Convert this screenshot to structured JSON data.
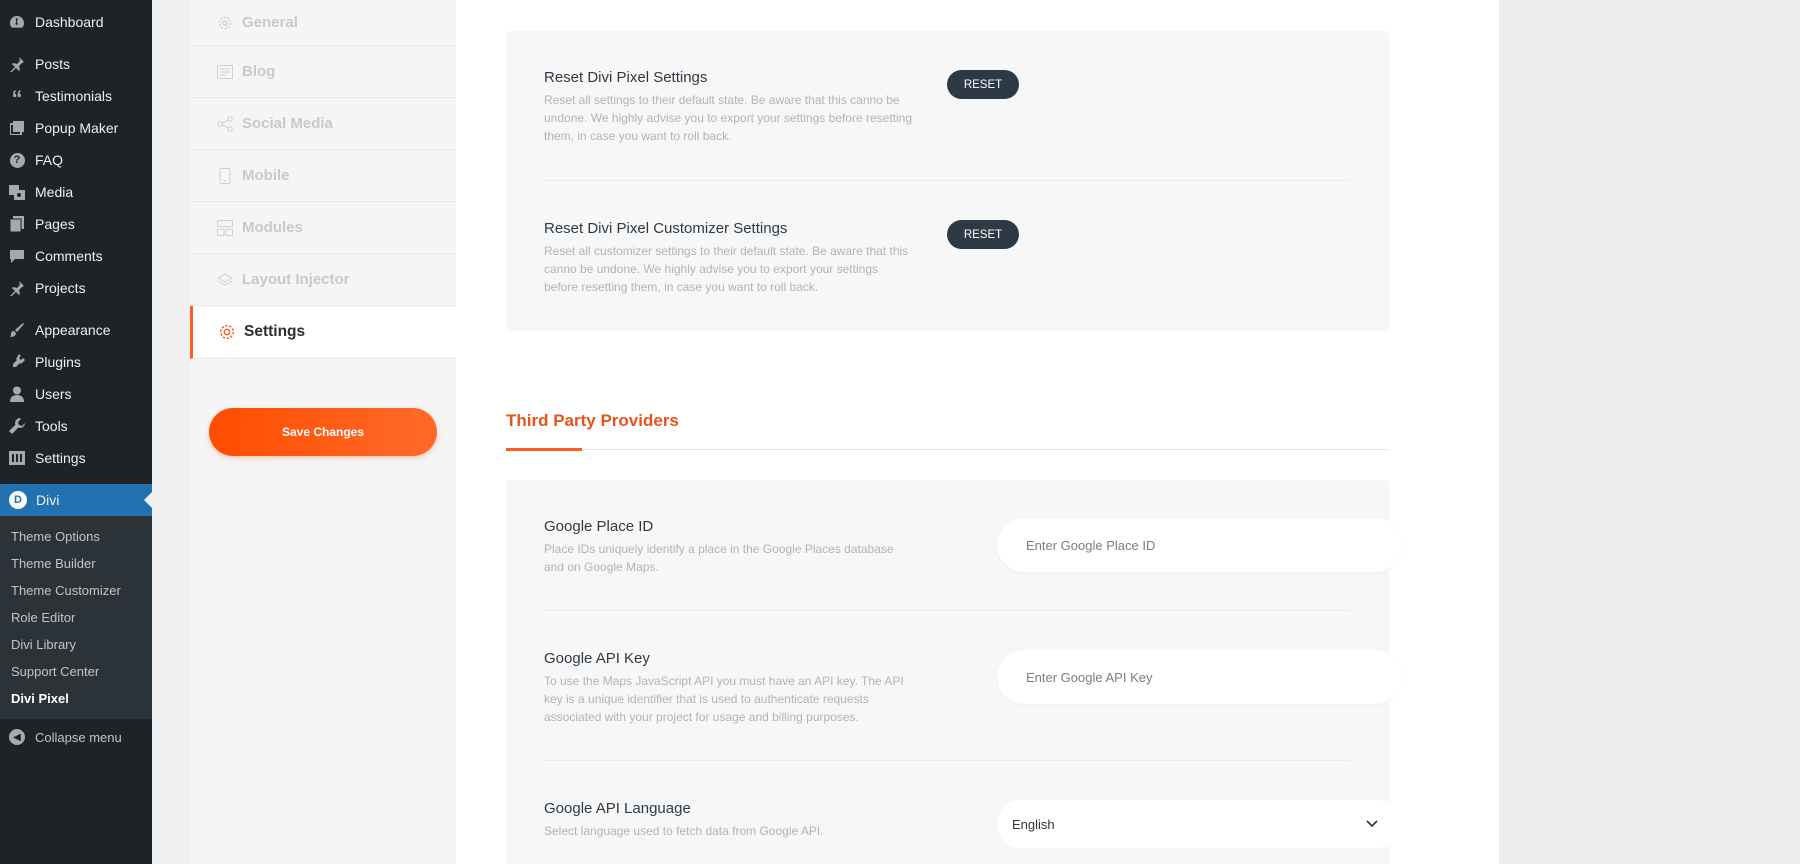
{
  "wp_menu": {
    "top": [
      {
        "label": "Dashboard",
        "icon": "dashboard-icon"
      }
    ],
    "group1": [
      {
        "label": "Posts",
        "icon": "pin-icon"
      },
      {
        "label": "Testimonials",
        "icon": "quote-icon"
      },
      {
        "label": "Popup Maker",
        "icon": "popup-icon"
      },
      {
        "label": "FAQ",
        "icon": "question-icon"
      },
      {
        "label": "Media",
        "icon": "media-icon"
      },
      {
        "label": "Pages",
        "icon": "pages-icon"
      },
      {
        "label": "Comments",
        "icon": "comment-icon"
      },
      {
        "label": "Projects",
        "icon": "pin-icon"
      }
    ],
    "group2": [
      {
        "label": "Appearance",
        "icon": "brush-icon"
      },
      {
        "label": "Plugins",
        "icon": "plug-icon"
      },
      {
        "label": "Users",
        "icon": "user-icon"
      },
      {
        "label": "Tools",
        "icon": "wrench-icon"
      },
      {
        "label": "Settings",
        "icon": "settings-icon"
      }
    ],
    "divi": {
      "label": "Divi",
      "logo": "D"
    },
    "submenu": [
      "Theme Options",
      "Theme Builder",
      "Theme Customizer",
      "Role Editor",
      "Divi Library",
      "Support Center",
      "Divi Pixel"
    ],
    "collapse": "Collapse menu"
  },
  "plugin_nav": {
    "items": [
      {
        "label": "General",
        "icon": "gear-icon"
      },
      {
        "label": "Blog",
        "icon": "blog-icon"
      },
      {
        "label": "Social Media",
        "icon": "share-icon"
      },
      {
        "label": "Mobile",
        "icon": "mobile-icon"
      },
      {
        "label": "Modules",
        "icon": "modules-icon"
      },
      {
        "label": "Layout Injector",
        "icon": "layers-icon"
      },
      {
        "label": "Settings",
        "icon": "gear-icon"
      }
    ],
    "save_label": "Save Changes"
  },
  "reset_section": {
    "rows": [
      {
        "title": "Reset Divi Pixel Settings",
        "desc": "Reset all settings to their default state. Be aware that this canno be undone. We highly advise you to export your settings before resetting them, in case you want to roll back.",
        "button": "RESET"
      },
      {
        "title": "Reset Divi Pixel Customizer Settings",
        "desc": "Reset all customizer settings to their default state. Be aware that this canno be undone. We highly advise you to export your settings before resetting them, in case you want to roll back.",
        "button": "RESET"
      }
    ]
  },
  "third_party": {
    "title": "Third Party Providers",
    "rows": [
      {
        "title": "Google Place ID",
        "desc": "Place IDs uniquely identify a place in the Google Places database and on Google Maps.",
        "placeholder": "Enter Google Place ID"
      },
      {
        "title": "Google API Key",
        "desc": "To use the Maps JavaScript API you must have an API key. The API key is a unique identifier that is used to authenticate requests associated with your project for usage and billing purposes.",
        "placeholder": "Enter Google API Key"
      },
      {
        "title": "Google API Language",
        "desc": "Select language used to fetch data from Google API.",
        "value": "English"
      }
    ]
  },
  "colors": {
    "accent": "#ff5a1f",
    "wp_sidebar": "#1d2327",
    "wp_active": "#2271b1",
    "button_dark": "#2d3a45"
  }
}
